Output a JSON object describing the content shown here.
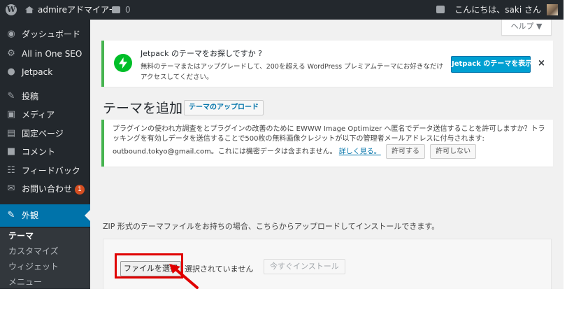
{
  "admin_bar": {
    "wp_logo_icon": "wordpress-icon",
    "site_name": "admireアドマイアー",
    "comments_count": "0",
    "howdy": "こんにちは、saki さん"
  },
  "sidebar": {
    "items": [
      {
        "label": "ダッシュボード",
        "icon": "dashboard-icon"
      },
      {
        "label": "All in One SEO",
        "icon": "gear-icon"
      },
      {
        "label": "Jetpack",
        "icon": "jetpack-icon"
      },
      {
        "label": "投稿",
        "icon": "pin-icon"
      },
      {
        "label": "メディア",
        "icon": "media-icon"
      },
      {
        "label": "固定ページ",
        "icon": "page-icon"
      },
      {
        "label": "コメント",
        "icon": "comment-icon"
      },
      {
        "label": "フィードバック",
        "icon": "feedback-icon"
      },
      {
        "label": "お問い合わせ",
        "icon": "mail-icon",
        "badge": "1"
      },
      {
        "label": "外観",
        "icon": "brush-icon"
      }
    ],
    "submenu": [
      "テーマ",
      "カスタマイズ",
      "ウィジェット",
      "メニュー"
    ]
  },
  "help": {
    "label": "ヘルプ ▼"
  },
  "jetpack_notice": {
    "title": "Jetpack のテーマをお探しですか ?",
    "description": "無料のテーマまたはアップグレードして、200を超える WordPress プレミアムテーマにお好きなだけアクセスしてください。",
    "button": "Jetpack のテーマを表示",
    "close": "×"
  },
  "page": {
    "title": "テーマを追加",
    "upload_button": "テーマのアップロード"
  },
  "ewww_notice": {
    "text": "プラグインの使われ方調査をとプラグインの改善のために EWWW Image Optimizer へ匿名でデータ送信することを許可しますか？トラッキングを有効しデータを送信することで500枚の無料画像クレジットが以下の管理者メールアドレスに付与されます: ",
    "email": "outbound.tokyo@gmail.com",
    "text2": "。これには機密データは含まれません。",
    "learn_more": "詳しく見る。",
    "allow": "許可する",
    "deny": "許可しない"
  },
  "upload": {
    "help_text": "ZIP 形式のテーマファイルをお持ちの場合、こちらからアップロードしてインストールできます。",
    "choose_file": "ファイルを選択",
    "no_file": "選択されていません",
    "install_now": "今すぐインストール"
  },
  "colors": {
    "sidebar": "#23282d",
    "current": "#0073aa",
    "accent_green": "#46b450",
    "highlight": "#e00000"
  }
}
